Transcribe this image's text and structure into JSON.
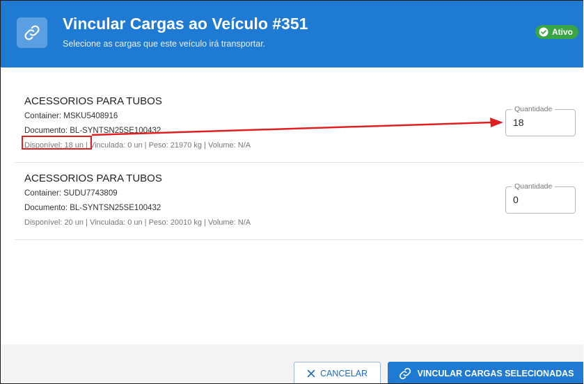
{
  "dialog": {
    "title": "Vincular Cargas ao Veículo #351",
    "subtitle": "Selecione as cargas que este veículo irá transportar.",
    "icon": "link-icon",
    "status_badge": "Ativo",
    "status_color": "#3aa545",
    "accent": "#1e7ad3"
  },
  "items": [
    {
      "name": "ACESSORIOS PARA TUBOS",
      "container": "Container: MSKU5408916",
      "documento": "Documento: BL-SYNTSN25SE100432",
      "details": "Disponível: 18 un | Vinculada: 0 un | Peso: 21970 kg | Volume: N/A",
      "quantity_label": "Quantidade",
      "quantity_value": "18"
    },
    {
      "name": "ACESSORIOS PARA TUBOS",
      "container": "Container: SUDU7743809",
      "documento": "Documento: BL-SYNTSN25SE100432",
      "details": "Disponível: 20 un | Vinculada: 0 un | Peso: 20010 kg | Volume: N/A",
      "quantity_label": "Quantidade",
      "quantity_value": "0"
    }
  ],
  "annotation": {
    "color": "#e02020"
  },
  "footer": {
    "cancel_label": "CANCELAR",
    "confirm_label": "VINCULAR CARGAS SELECIONADAS"
  }
}
